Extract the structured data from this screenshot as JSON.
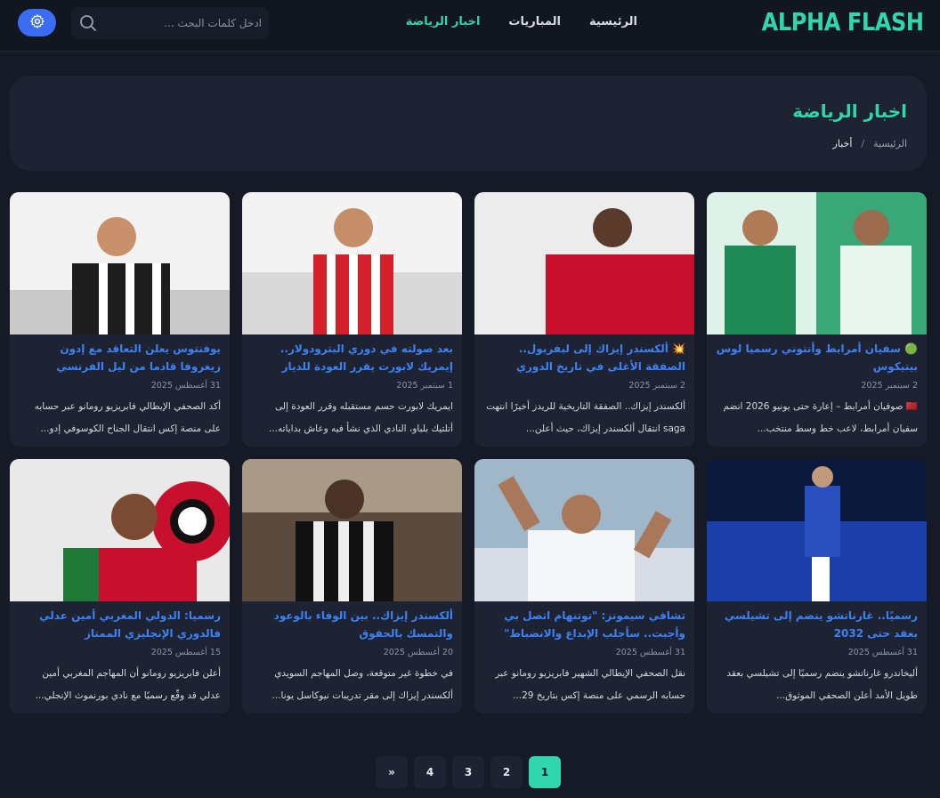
{
  "brand": {
    "logo": "ALPHA FLASH"
  },
  "nav": {
    "items": [
      {
        "label": "الرئيسية"
      },
      {
        "label": "المباريات"
      },
      {
        "label": "اخبار الرياضة"
      }
    ],
    "active_index": 2
  },
  "search": {
    "placeholder": "ادخل كلمات البحث ..."
  },
  "page": {
    "title": "اخبار الرياضة",
    "breadcrumb": [
      "الرئيسية",
      "أخبار"
    ],
    "breadcrumb_separator": "/"
  },
  "articles": [
    {
      "title": "🟢 سفيان أمرابط وأنتوني رسميا لوس بيتيكوس",
      "date": "2 سبتمبر 2025",
      "excerpt": "🇲🇦 صوفيان أمرابط – إعارة حتى يونيو 2026 انضم سفيان أمرابط، لاعب خط وسط منتخب...",
      "thumb_bg": "#3aa776"
    },
    {
      "title": "💥 ألكسندر إيزاك إلى ليفربول.. الصفقة الأغلى في تاريخ الدوري الإنجليزي",
      "date": "2 سبتمبر 2025",
      "excerpt": "ألكسندر إيزاك.. الصفقة التاريخية للريدز أخيرًا انتهت saga انتقال ألكسندر إيزاك، حيث أعلن...",
      "thumb_bg": "#ececec"
    },
    {
      "title": "بعد صولته في دوري البترودولار.. إيمريك لابورت يقرر العودة للديار",
      "date": "1 سبتمبر 2025",
      "excerpt": "ايمريك لابورت حسم مستقبله وقرر العودة إلى أتلتيك بلباو، النادي الذي نشأ فيه وعاش بداياته...",
      "thumb_bg": "#f3f3f3"
    },
    {
      "title": "يوفنتوس يعلن التعاقد مع إدون زيغروفا قادما من ليل الفرنسي",
      "date": "31 أغسطس 2025",
      "excerpt": "أكد الصحفي الإيطالي فابريزيو رومانو عبر حسابه على منصة إكس انتقال الجناح الكوسوفي إدو...",
      "thumb_bg": "#f2f2f2"
    },
    {
      "title": "رسميًا.. غارناتشو ينضم إلى تشيلسي بعقد حتى 2032",
      "date": "31 أغسطس 2025",
      "excerpt": "أليخاندرو غارناتشو ينضم رسميًا إلى تشيلسي بعقد طويل الأمد أعلن الصحفي الموثوق...",
      "thumb_bg": "#0b1a3c"
    },
    {
      "title": "تشافي سيمونز: \"توتنهام اتصل بي وأجبت.. سأجلب الإبداع والانضباط\"",
      "date": "31 أغسطس 2025",
      "excerpt": "نقل الصحفي الإيطالي الشهير فابريزيو رومانو عبر حسابه الرسمي على منصة إكس بتاريخ 29...",
      "thumb_bg": "#9fb7c9"
    },
    {
      "title": "ألكسندر إيزاك.. بين الوفاء بالوعود والتمسك بالحقوق",
      "date": "20 أغسطس 2025",
      "excerpt": "في خطوة غير متوقعة، وصل المهاجم السويدي ألكسندر إيزاك إلى مقر تدريبات نيوكاسل يونا...",
      "thumb_bg": "#5b4a3e"
    },
    {
      "title": "رسميا: الدولي المغربي أمين عدلي فالدوري الإنجليزي الممتاز",
      "date": "15 أغسطس 2025",
      "excerpt": "أعلن فابريزيو رومانو أن المهاجم المغربي أمين عدلي قد وقّع رسميًا مع نادي بورنموث الإنجلي...",
      "thumb_bg": "#e9e9e9"
    }
  ],
  "pagination": {
    "pages": [
      "1",
      "2",
      "3",
      "4"
    ],
    "next_label": "»",
    "current": "1"
  },
  "colors": {
    "accent": "#2fd6ae",
    "link": "#3d82f5",
    "background": "#151a26",
    "card": "#1d2333",
    "settings_button": "#3a6cf4"
  }
}
